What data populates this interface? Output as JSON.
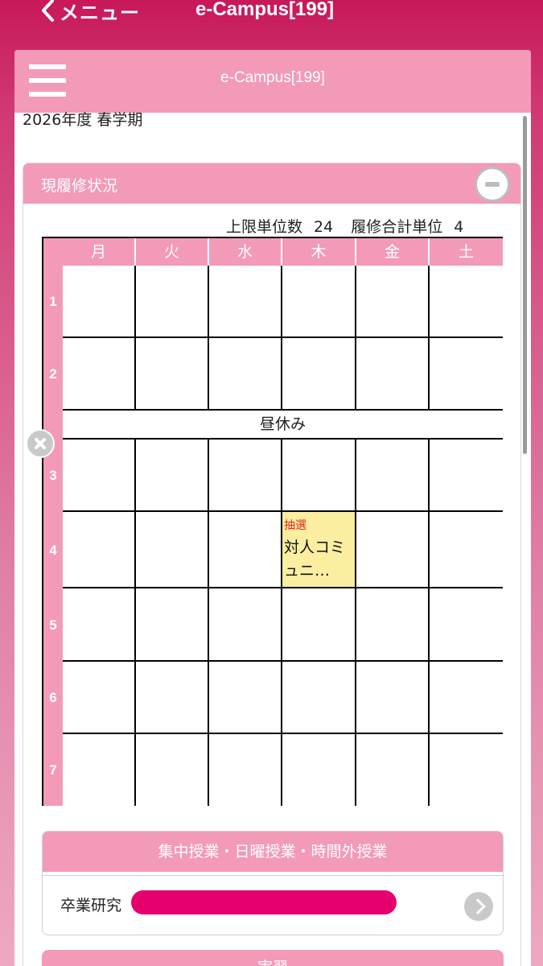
{
  "nav": {
    "back_label": "メニュー",
    "title": "e-Campus[199]"
  },
  "app": {
    "title": "e-Campus[199]",
    "term": "2026年度 春学期"
  },
  "section": {
    "title": "現履修状況",
    "credit_limit_label": "上限単位数",
    "credit_limit": "24",
    "credit_total_label": "履修合計単位",
    "credit_total": "4"
  },
  "timetable": {
    "days": [
      "月",
      "火",
      "水",
      "木",
      "金",
      "土"
    ],
    "periods": [
      "1",
      "2",
      "3",
      "4",
      "5",
      "6",
      "7"
    ],
    "lunch_label": "昼休み",
    "courses": [
      {
        "day": "木",
        "period": "4",
        "tag": "抽選",
        "name": "対人コミュニ…"
      }
    ]
  },
  "intensive": {
    "title": "集中授業・日曜授業・時間外授業",
    "item_label": "卒業研究"
  },
  "next_section": {
    "title": "実習"
  },
  "colors": {
    "brand": "#c8185a",
    "header_pink": "#f39ab8",
    "course_bg": "#fceea0",
    "tag_red": "#e8231c",
    "redaction": "#e6006e"
  }
}
